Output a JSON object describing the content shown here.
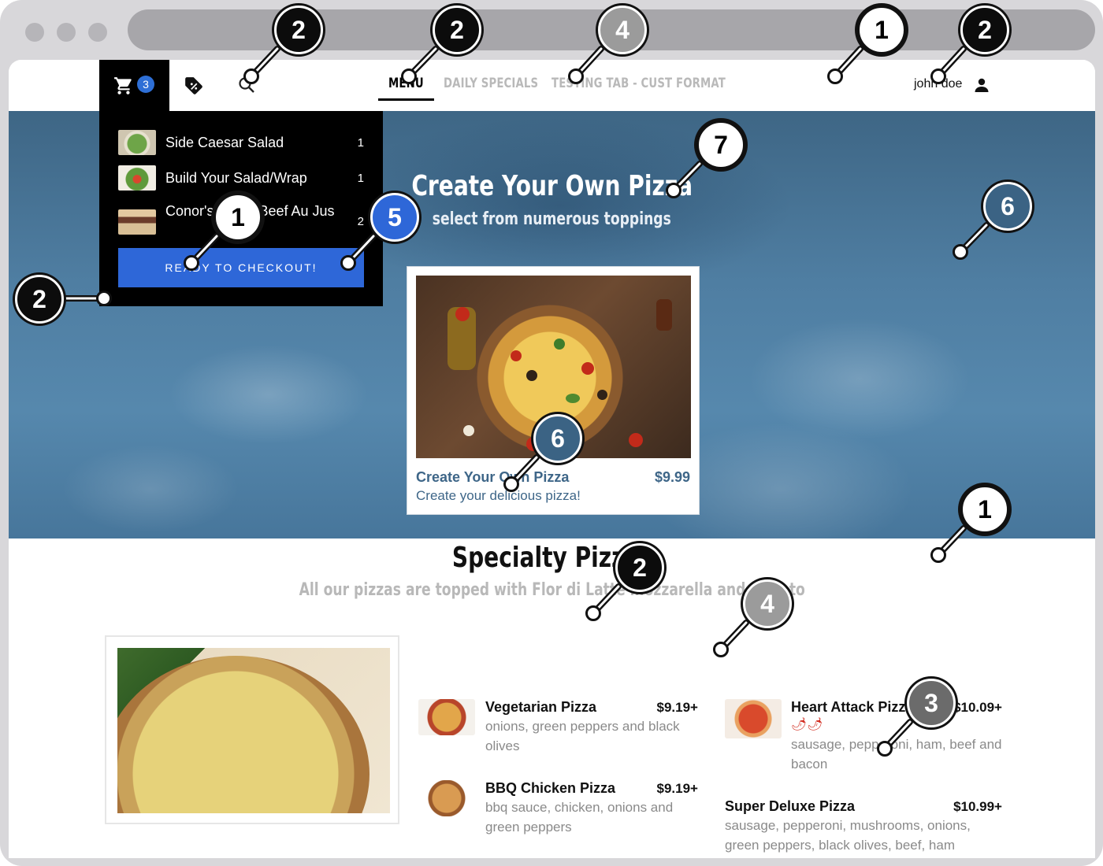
{
  "header": {
    "cart_count": "3",
    "tabs": [
      {
        "label": "MENU",
        "active": true
      },
      {
        "label": "DAILY SPECIALS",
        "active": false
      },
      {
        "label": "TESTING TAB - CUST FORMAT",
        "active": false
      }
    ],
    "user_name": "john doe",
    "icons": [
      "cart-icon",
      "coupon-tag-icon",
      "search-icon",
      "user-icon"
    ]
  },
  "cart": {
    "items": [
      {
        "name": "Side Caesar Salad",
        "qty": "1"
      },
      {
        "name": "Build Your Salad/Wrap",
        "qty": "1"
      },
      {
        "name": "Conor's Roast Beef Au Jus",
        "qty": "2"
      }
    ],
    "checkout_label": "READY TO CHECKOUT!"
  },
  "hero": {
    "title": "Create Your Own Pizza",
    "subtitle": "select from numerous toppings",
    "card": {
      "name": "Create Your Own Pizza",
      "price": "$9.99",
      "description": "Create your delicious pizza!"
    }
  },
  "specialty": {
    "title": "Specialty Pizzas",
    "subtitle": "All our pizzas are topped with Flor di Latte mozzarella and tomato",
    "items": [
      {
        "name": "Vegetarian Pizza",
        "price": "$9.19+",
        "description": "onions, green peppers and black olives"
      },
      {
        "name": "BBQ Chicken Pizza",
        "price": "$9.19+",
        "description": "bbq sauce, chicken, onions and green peppers"
      },
      {
        "name": "Heart Attack Pizza",
        "price": "$10.09+",
        "description": "sausage, pepperoni, ham, beef and bacon",
        "badge": "🌶🌶"
      },
      {
        "name": "Super Deluxe Pizza",
        "price": "$10.99+",
        "description": "sausage, pepperoni, mushrooms, onions, green peppers, black olives, beef, ham"
      }
    ]
  },
  "callouts": [
    "2",
    "2",
    "4",
    "1",
    "2",
    "7",
    "6",
    "1",
    "5",
    "2",
    "6",
    "1",
    "2",
    "4",
    "3"
  ],
  "colors": {
    "accent": "#2e67d8",
    "hero_blue": "#4f7ea2",
    "card_text": "#3e6688",
    "muted": "#8a8a8a"
  }
}
